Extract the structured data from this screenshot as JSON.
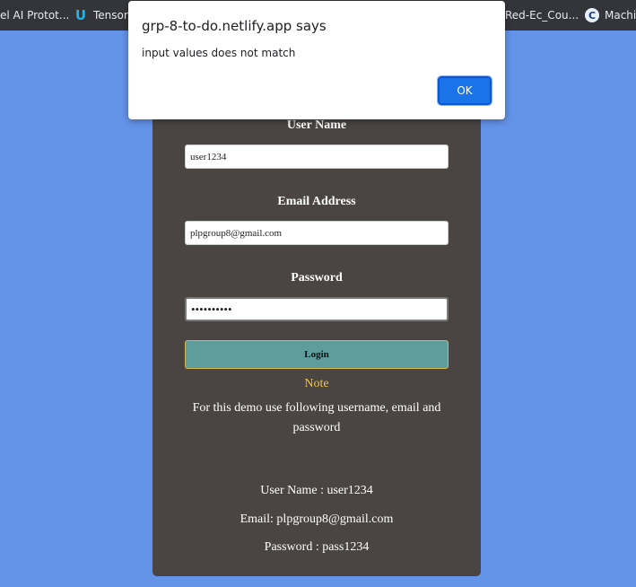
{
  "bookmarks": [
    {
      "icon": "",
      "label": "el AI Protot..."
    },
    {
      "icon": "udacity-icon",
      "label": "Tensor"
    },
    {
      "icon": "",
      "label": "Red-Ec_Cou..."
    },
    {
      "icon": "coursera-icon",
      "label": "Machi"
    }
  ],
  "dialog": {
    "title": "grp-8-to-do.netlify.app says",
    "message": "input values does not match",
    "ok_label": "OK"
  },
  "form": {
    "username_label": "User Name",
    "username_value": "user1234",
    "email_label": "Email Address",
    "email_value": "plpgroup8@gmail.com",
    "password_label": "Password",
    "password_value": "pass123456",
    "login_label": "Login"
  },
  "note": {
    "title": "Note",
    "description": "For this demo use following username, email and password",
    "username_line": "User Name : user1234",
    "email_line": "Email: plpgroup8@gmail.com",
    "password_line": "Password : pass1234"
  },
  "colors": {
    "background": "#6493ea",
    "card": "#4a4543",
    "login_button": "#5f9c9c",
    "note": "#f4c430",
    "ok_button": "#1a73e8"
  }
}
